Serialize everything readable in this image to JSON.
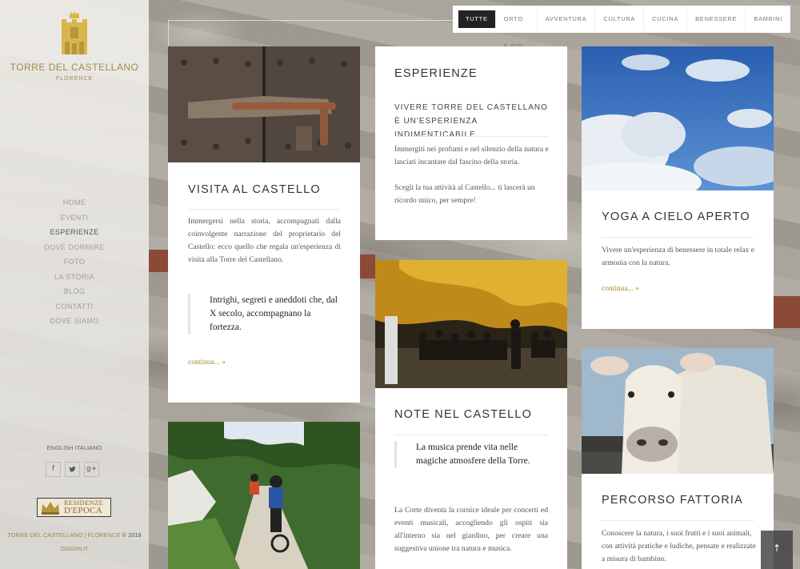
{
  "brand": {
    "title": "TORRE DEL CASTELLANO",
    "subtitle": "FLORENCE",
    "gold": "#a08a4e"
  },
  "nav": {
    "items": [
      "HOME",
      "EVENTI",
      "ESPERIENZE",
      "DOVE DORMIRE",
      "FOTO",
      "LA STORIA",
      "BLOG",
      "CONTATTI",
      "DOVE SIAMO"
    ],
    "active": "ESPERIENZE"
  },
  "languages": {
    "en": "ENGLISH",
    "it": "ITALIANO"
  },
  "social": {
    "facebook": "f",
    "twitter": "twitter-icon",
    "googleplus": "g+"
  },
  "residenze": {
    "line1": "RESIDENZE",
    "line2": "D'EPOCA"
  },
  "footer": {
    "copyright_name": "TORRE DEL CASTELLANO | FLORENCE",
    "copyright_year": "© 2018",
    "credit": "DIADAN.IT"
  },
  "filters": [
    "TUTTE",
    "ORTO E BIO",
    "AVVENTURA",
    "CULTURA",
    "CUCINA",
    "BENESSERE",
    "BAMBINI"
  ],
  "filter_active": "TUTTE",
  "cards": {
    "visita": {
      "title": "VISITA AL CASTELLO",
      "text": "Immergersi nella storia, accompagnati dalla coinvolgente narrazione del proprietario del Castello: ecco quello che regala un'esperienza di visita alla Torre del Castellano.",
      "quote": "Intrighi, segreti e aneddoti che, dal X secolo, accompagnano la fortezza.",
      "more": "continua... »"
    },
    "esperienze": {
      "title": "ESPERIENZE",
      "subtitle": "VIVERE TORRE DEL CASTELLANO È UN'ESPERIENZA INDIMENTICABILE.",
      "text1": "Immergiti nei profumi e nel silenzio della natura e lasciati incantare dal fascino della storia.",
      "text2": "Scegli la tua attività al Castello... ti lascerà un ricordo unico, per sempre!"
    },
    "note": {
      "title": "NOTE NEL CASTELLO",
      "quote": "La musica prende vita nelle magiche atmosfere della Torre.",
      "text": "La Corte diventa la cornice ideale per concerti ed eventi musicali, accogliendo gli ospiti sia all'interno sia nel giardino, per creare una suggestiva unione tra natura e musica."
    },
    "yoga": {
      "title": "YOGA A CIELO APERTO",
      "text": "Vivere un'esperienza di benessere in totale relax e armonia con la natura.",
      "more": "continua... »"
    },
    "fattoria": {
      "title": "PERCORSO FATTORIA",
      "text": "Conoscere la natura, i suoi frutti e i suoi animali, con attività pratiche e ludiche, pensate e realizzate a misura di bambino."
    }
  },
  "totop": "↑"
}
